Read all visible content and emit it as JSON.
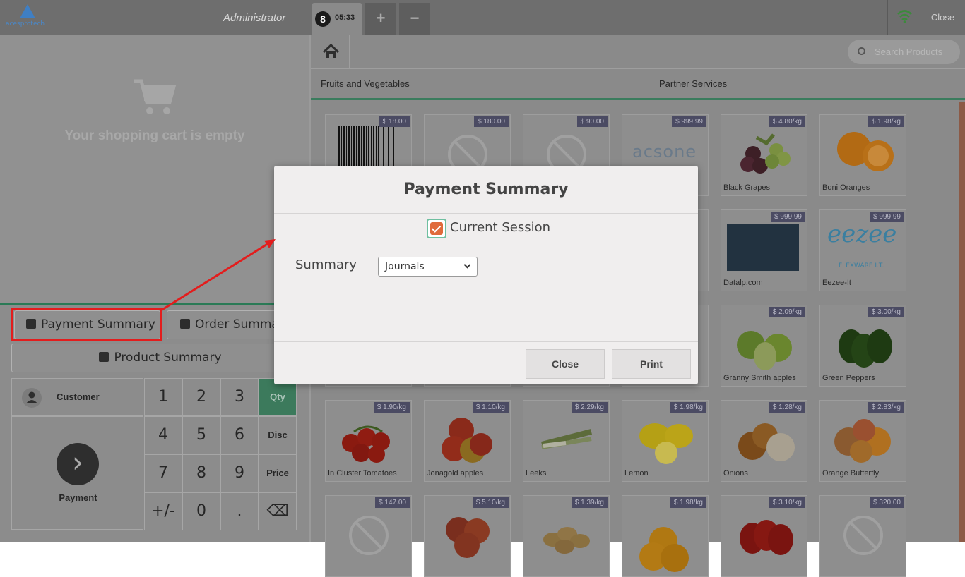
{
  "topbar": {
    "logo_text": "acesprotech",
    "user": "Administrator",
    "order_number": "8",
    "order_time": "05:33",
    "add_label": "+",
    "remove_label": "−",
    "close_label": "Close"
  },
  "cart": {
    "empty_text": "Your shopping cart is empty"
  },
  "controls": {
    "payment_summary": "Payment Summary",
    "order_summary": "Order Summary",
    "product_summary": "Product Summary",
    "customer": "Customer",
    "payment": "Payment"
  },
  "numpad": {
    "keys": [
      "1",
      "2",
      "3",
      "Qty",
      "4",
      "5",
      "6",
      "Disc",
      "7",
      "8",
      "9",
      "Price",
      "+/-",
      "0",
      ".",
      "⌫"
    ]
  },
  "search": {
    "placeholder": "Search Products"
  },
  "categories": [
    "Fruits and Vegetables",
    "Partner Services"
  ],
  "products": [
    {
      "name": "",
      "price": "$ 18.00",
      "img": "barcode"
    },
    {
      "name": "",
      "price": "$ 180.00",
      "img": "none"
    },
    {
      "name": "",
      "price": "$ 90.00",
      "img": "none"
    },
    {
      "name": "",
      "price": "$ 999.99",
      "img": "acsone"
    },
    {
      "name": "Black Grapes",
      "price": "$ 4.80/kg",
      "img": "grapes"
    },
    {
      "name": "Boni Oranges",
      "price": "$ 1.98/kg",
      "img": "oranges"
    },
    {
      "name": "",
      "price": "",
      "img": "none"
    },
    {
      "name": "",
      "price": "",
      "img": "none"
    },
    {
      "name": "",
      "price": "",
      "img": "none"
    },
    {
      "name": "",
      "price": "",
      "img": "none"
    },
    {
      "name": "Datalp.com",
      "price": "$ 999.99",
      "img": "datalp"
    },
    {
      "name": "Eezee-It",
      "price": "$ 999.99",
      "img": "eezee"
    },
    {
      "name": "",
      "price": "",
      "img": "none"
    },
    {
      "name": "",
      "price": "",
      "img": "none"
    },
    {
      "name": "",
      "price": "",
      "img": "none"
    },
    {
      "name": "",
      "price": "",
      "img": "none"
    },
    {
      "name": "Granny Smith apples",
      "price": "$ 2.09/kg",
      "img": "apples-green"
    },
    {
      "name": "Green Peppers",
      "price": "$ 3.00/kg",
      "img": "peppers-green"
    },
    {
      "name": "In Cluster Tomatoes",
      "price": "$ 1.90/kg",
      "img": "tomatoes"
    },
    {
      "name": "Jonagold apples",
      "price": "$ 1.10/kg",
      "img": "apples-red"
    },
    {
      "name": "Leeks",
      "price": "$ 2.29/kg",
      "img": "leeks"
    },
    {
      "name": "Lemon",
      "price": "$ 1.98/kg",
      "img": "lemon"
    },
    {
      "name": "Onions",
      "price": "$ 1.28/kg",
      "img": "onions"
    },
    {
      "name": "Orange Butterfly",
      "price": "$ 2.83/kg",
      "img": "butterfly"
    },
    {
      "name": "",
      "price": "$ 147.00",
      "img": "none"
    },
    {
      "name": "",
      "price": "$ 5.10/kg",
      "img": "peaches"
    },
    {
      "name": "",
      "price": "$ 1.39/kg",
      "img": "potatoes"
    },
    {
      "name": "",
      "price": "$ 1.98/kg",
      "img": "oranges2"
    },
    {
      "name": "",
      "price": "$ 3.10/kg",
      "img": "peppers-red"
    },
    {
      "name": "",
      "price": "$ 320.00",
      "img": "none"
    }
  ],
  "modal": {
    "title": "Payment Summary",
    "checkbox_label": "Current Session",
    "checkbox_checked": true,
    "summary_label": "Summary",
    "summary_value": "Journals",
    "close_label": "Close",
    "print_label": "Print"
  },
  "colors": {
    "accent_green": "#3a7c5d",
    "checkbox_orange": "#e06a3b",
    "highlight_red": "#e31d1d"
  }
}
